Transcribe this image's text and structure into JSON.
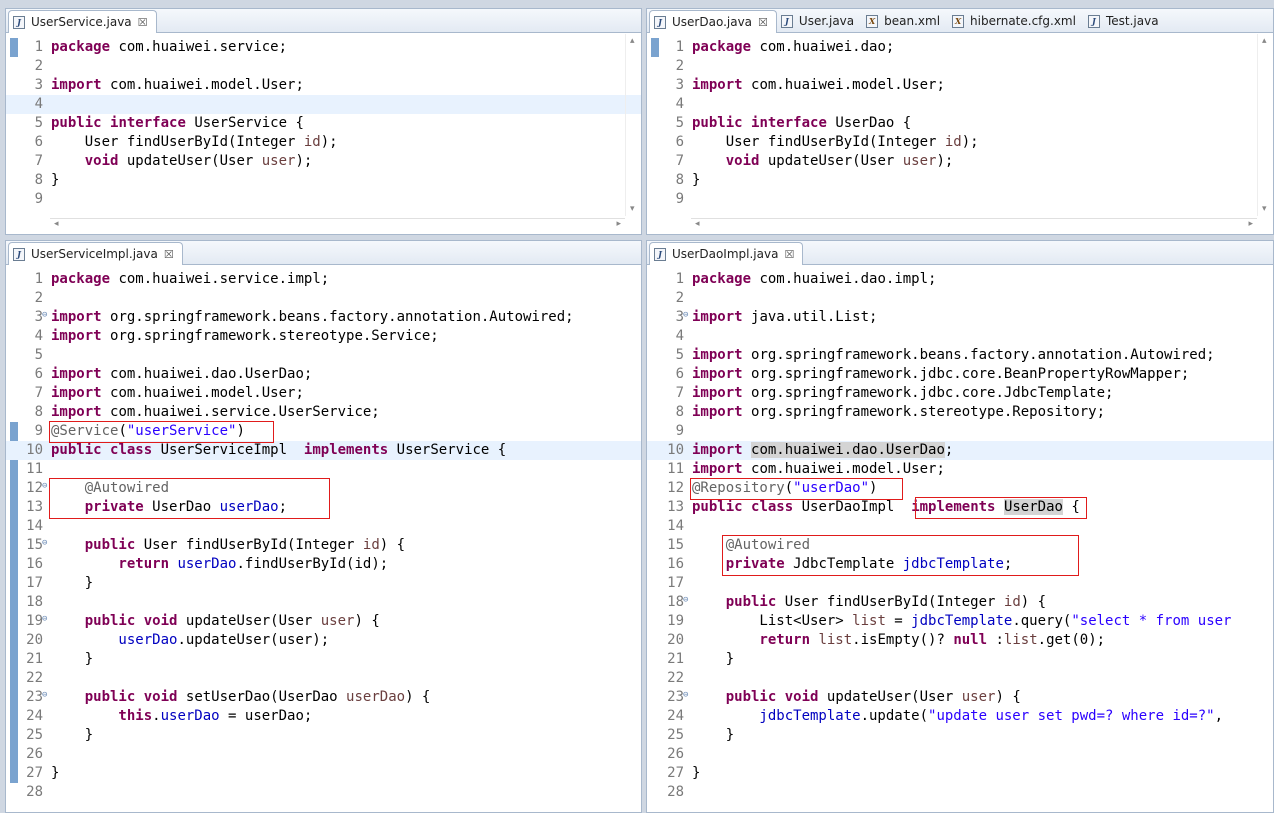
{
  "panes": {
    "top_left": {
      "tabs": [
        {
          "label": "UserService.java",
          "icon": "J",
          "closable": true
        }
      ],
      "lines": [
        [
          [
            "kw",
            "package"
          ],
          [
            "",
            "com.huaiwei.service;"
          ]
        ],
        [],
        [
          [
            "kw",
            "import"
          ],
          [
            "",
            "com.huaiwei.model.User;"
          ]
        ],
        [],
        [
          [
            "kw",
            "public"
          ],
          [
            "kw",
            "interface"
          ],
          [
            "",
            "UserService {"
          ]
        ],
        [
          [
            "",
            "    User findUserById(Integer "
          ],
          [
            "pv",
            "id"
          ],
          [
            ");"
          ]
        ],
        [
          [
            "kw",
            "    void"
          ],
          [
            "",
            "updateUser(User "
          ],
          [
            "pv",
            "user"
          ],
          [
            ");"
          ]
        ],
        [
          [
            "",
            "}"
          ]
        ],
        []
      ]
    },
    "top_right": {
      "tabs": [
        {
          "label": "UserDao.java",
          "icon": "J",
          "closable": true
        },
        {
          "label": "User.java",
          "icon": "J"
        },
        {
          "label": "bean.xml",
          "icon": "X"
        },
        {
          "label": "hibernate.cfg.xml",
          "icon": "X"
        },
        {
          "label": "Test.java",
          "icon": "J"
        }
      ],
      "lines": [
        [
          [
            "kw",
            "package"
          ],
          [
            "",
            "com.huaiwei.dao;"
          ]
        ],
        [],
        [
          [
            "kw",
            "import"
          ],
          [
            "",
            "com.huaiwei.model.User;"
          ]
        ],
        [],
        [
          [
            "kw",
            "public"
          ],
          [
            "kw",
            "interface"
          ],
          [
            "",
            "UserDao {"
          ]
        ],
        [
          [
            "",
            "    User findUserById(Integer "
          ],
          [
            "pv",
            "id"
          ],
          [
            ");"
          ]
        ],
        [
          [
            "kw",
            "    void"
          ],
          [
            "",
            "updateUser(User "
          ],
          [
            "pv",
            "user"
          ],
          [
            ");"
          ]
        ],
        [
          [
            "",
            "}"
          ]
        ],
        []
      ]
    },
    "bottom_left": {
      "tabs": [
        {
          "label": "UserServiceImpl.java",
          "icon": "J",
          "closable": true
        }
      ],
      "lines": [
        [
          [
            "kw",
            "package"
          ],
          [
            "",
            "com.huaiwei.service.impl;"
          ]
        ],
        [],
        [
          [
            "kw",
            "import"
          ],
          [
            "",
            "org.springframework.beans.factory.annotation.Autowired;"
          ]
        ],
        [
          [
            "kw",
            "import"
          ],
          [
            "",
            "org.springframework.stereotype.Service;"
          ]
        ],
        [],
        [
          [
            "kw",
            "import"
          ],
          [
            "",
            "com.huaiwei.dao.UserDao;"
          ]
        ],
        [
          [
            "kw",
            "import"
          ],
          [
            "",
            "com.huaiwei.model.User;"
          ]
        ],
        [
          [
            "kw",
            "import"
          ],
          [
            "",
            "com.huaiwei.service.UserService;"
          ]
        ],
        [
          [
            "an",
            "@Service"
          ],
          [
            "",
            "("
          ],
          [
            "st",
            "\"userService\""
          ],
          [
            ")"
          ]
        ],
        [
          [
            "kw",
            "public"
          ],
          [
            "kw",
            "class"
          ],
          [
            "",
            "UserServiceImpl "
          ],
          [
            "kw",
            "implements"
          ],
          [
            "",
            "UserService {"
          ]
        ],
        [],
        [
          [
            "an",
            "    @Autowired"
          ]
        ],
        [
          [
            "kw",
            "    private"
          ],
          [
            "",
            "UserDao "
          ],
          [
            "fd",
            "userDao"
          ],
          [
            ";"
          ]
        ],
        [],
        [
          [
            "kw",
            "    public"
          ],
          [
            "",
            "User findUserById(Integer "
          ],
          [
            "pv",
            "id"
          ],
          [
            ") {"
          ]
        ],
        [
          [
            "kw",
            "        return"
          ],
          [
            "fd",
            "userDao"
          ],
          [
            ".findUserById(id);"
          ]
        ],
        [
          [
            "",
            "    }"
          ]
        ],
        [],
        [
          [
            "kw",
            "    public"
          ],
          [
            "kw",
            "void"
          ],
          [
            "",
            "updateUser(User "
          ],
          [
            "pv",
            "user"
          ],
          [
            ") {"
          ]
        ],
        [
          [
            "fd",
            "        userDao"
          ],
          [
            ".updateUser(user);"
          ]
        ],
        [
          [
            "",
            "    }"
          ]
        ],
        [],
        [
          [
            "kw",
            "    public"
          ],
          [
            "kw",
            "void"
          ],
          [
            "",
            "setUserDao(UserDao "
          ],
          [
            "pv",
            "userDao"
          ],
          [
            ") {"
          ]
        ],
        [
          [
            "kw",
            "        this"
          ],
          [
            "",
            "."
          ],
          [
            "fd",
            "userDao"
          ],
          [
            " = userDao;"
          ]
        ],
        [
          [
            "",
            "    }"
          ]
        ],
        [],
        [
          [
            "",
            "}"
          ]
        ],
        []
      ]
    },
    "bottom_right": {
      "tabs": [
        {
          "label": "UserDaoImpl.java",
          "icon": "J",
          "closable": true
        }
      ],
      "lines": [
        [
          [
            "kw",
            "package"
          ],
          [
            "",
            "com.huaiwei.dao.impl;"
          ]
        ],
        [],
        [
          [
            "kw",
            "import"
          ],
          [
            "",
            "java.util.List;"
          ]
        ],
        [],
        [
          [
            "kw",
            "import"
          ],
          [
            "",
            "org.springframework.beans.factory.annotation.Autowired;"
          ]
        ],
        [
          [
            "kw",
            "import"
          ],
          [
            "",
            "org.springframework.jdbc.core.BeanPropertyRowMapper;"
          ]
        ],
        [
          [
            "kw",
            "import"
          ],
          [
            "",
            "org.springframework.jdbc.core.JdbcTemplate;"
          ]
        ],
        [
          [
            "kw",
            "import"
          ],
          [
            "",
            "org.springframework.stereotype.Repository;"
          ]
        ],
        [],
        [
          [
            "kw",
            "import"
          ],
          [
            "hl",
            "com.huaiwei.dao.UserDao"
          ],
          [
            ";"
          ]
        ],
        [
          [
            "kw",
            "import"
          ],
          [
            "",
            "com.huaiwei.model.User;"
          ]
        ],
        [
          [
            "an",
            "@Repository"
          ],
          [
            "",
            "("
          ],
          [
            "st",
            "\"userDao\""
          ],
          [
            ")"
          ]
        ],
        [
          [
            "kw",
            "public"
          ],
          [
            "kw",
            "class"
          ],
          [
            "",
            "UserDaoImpl "
          ],
          [
            "kw",
            "implements"
          ],
          [
            "hl",
            "UserDao"
          ],
          [
            " {"
          ]
        ],
        [],
        [
          [
            "an",
            "    @Autowired"
          ]
        ],
        [
          [
            "kw",
            "    private"
          ],
          [
            "",
            "JdbcTemplate "
          ],
          [
            "fd",
            "jdbcTemplate"
          ],
          [
            ";"
          ]
        ],
        [],
        [
          [
            "kw",
            "    public"
          ],
          [
            "",
            "User findUserById(Integer "
          ],
          [
            "pv",
            "id"
          ],
          [
            ") {"
          ]
        ],
        [
          [
            "",
            "        List<User> "
          ],
          [
            "pv",
            "list"
          ],
          [
            " = "
          ],
          [
            "fd",
            "jdbcTemplate"
          ],
          [
            ".query("
          ],
          [
            "st",
            "\"select * from user"
          ]
        ],
        [
          [
            "kw",
            "        return"
          ],
          [
            "pv",
            "list"
          ],
          [
            ".isEmpty()?"
          ],
          [
            "kw",
            "null"
          ],
          [
            ":"
          ],
          [
            "pv",
            "list"
          ],
          [
            ".get(0);"
          ]
        ],
        [
          [
            "",
            "    }"
          ]
        ],
        [],
        [
          [
            "kw",
            "    public"
          ],
          [
            "kw",
            "void"
          ],
          [
            "",
            "updateUser(User "
          ],
          [
            "pv",
            "user"
          ],
          [
            ") {"
          ]
        ],
        [
          [
            "fd",
            "        jdbcTemplate"
          ],
          [
            ".update("
          ],
          [
            "st",
            "\"update user set pwd=? where id=?\""
          ],
          [
            ","
          ]
        ],
        [
          [
            "",
            "    }"
          ]
        ],
        [],
        [
          [
            "",
            "}"
          ]
        ],
        []
      ]
    }
  }
}
